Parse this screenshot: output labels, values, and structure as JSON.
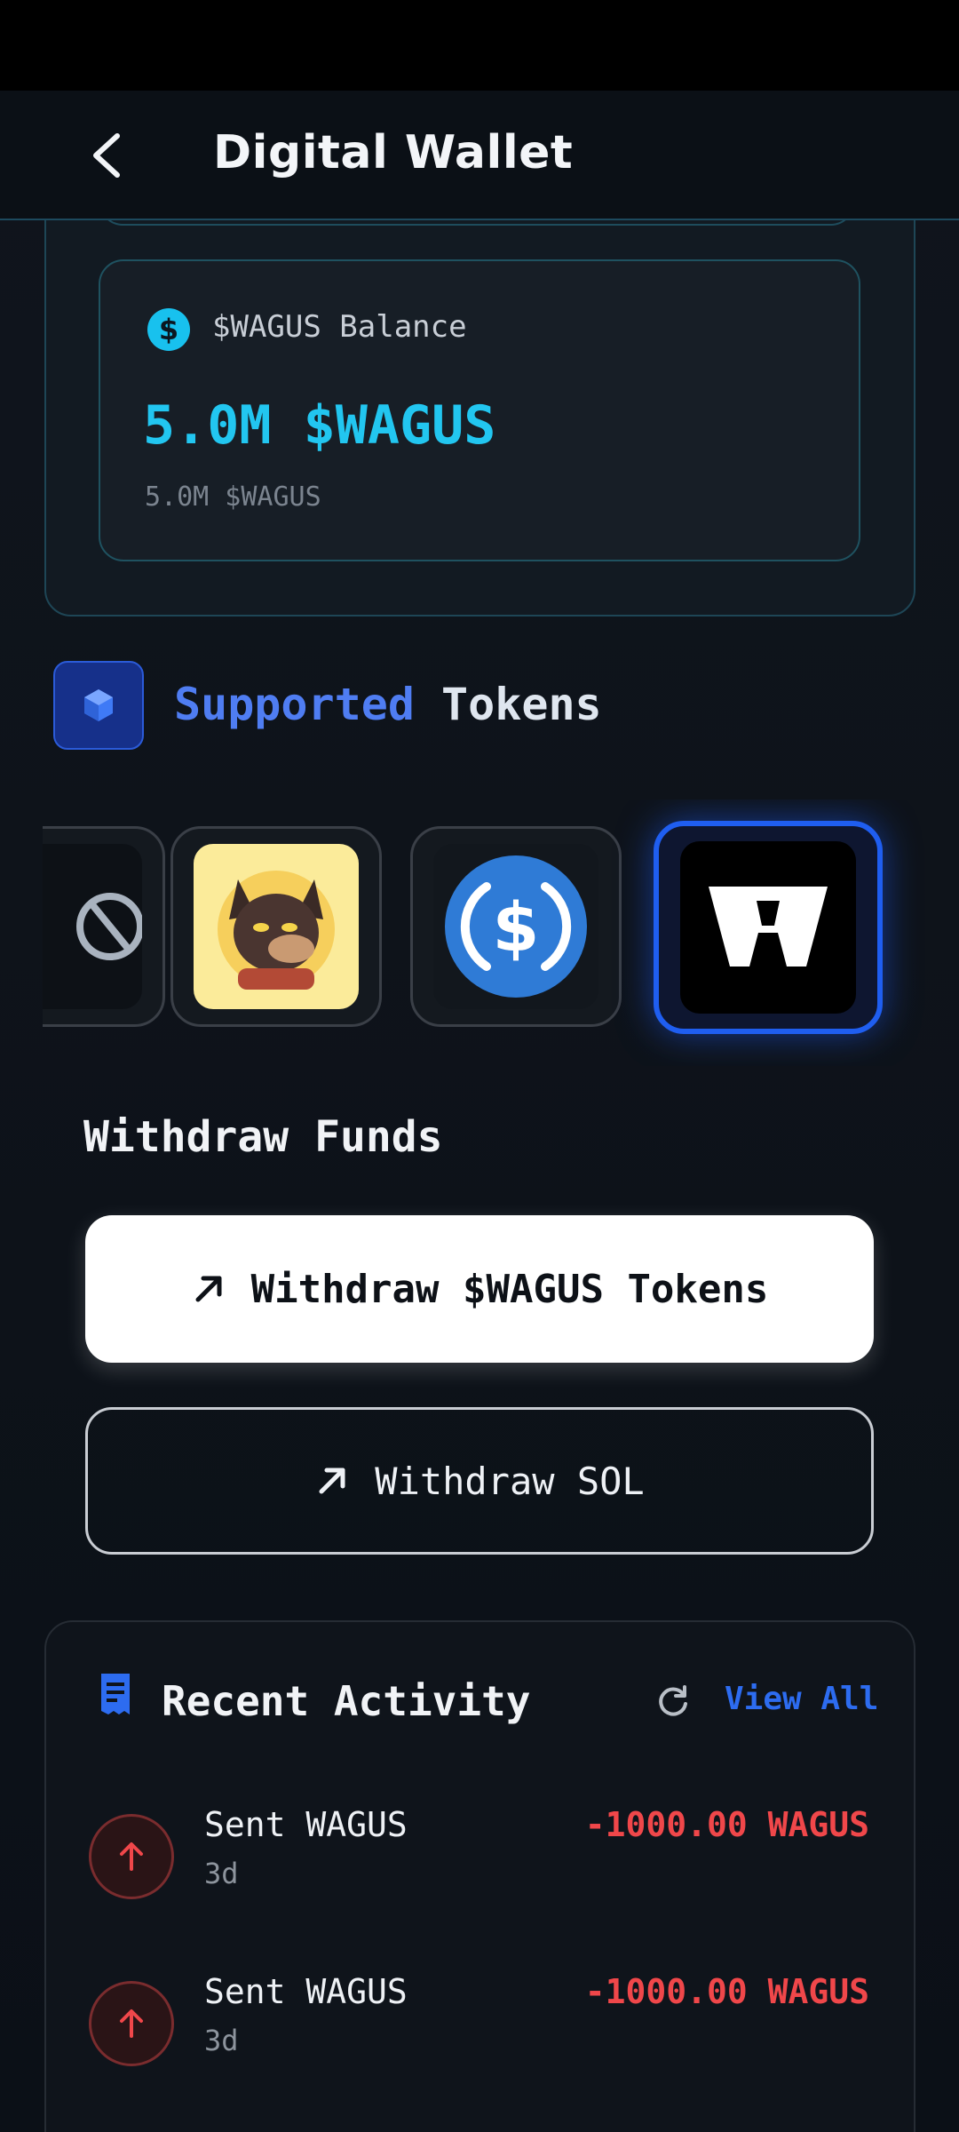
{
  "header": {
    "title": "Digital Wallet"
  },
  "balance": {
    "label": "$WAGUS Balance",
    "amount": "5.0M $WAGUS",
    "sub_amount": "5.0M $WAGUS"
  },
  "supported_tokens": {
    "title_highlight": "Supported",
    "title_rest": " Tokens",
    "tokens": [
      {
        "icon": "partial-token-icon"
      },
      {
        "icon": "wolf-token-icon"
      },
      {
        "icon": "usdc-icon"
      },
      {
        "icon": "wagus-logo-icon",
        "logo_text": "W",
        "selected": true
      }
    ]
  },
  "withdraw": {
    "title": "Withdraw Funds",
    "primary_label": "Withdraw $WAGUS Tokens",
    "secondary_label": "Withdraw SOL"
  },
  "activity": {
    "title": "Recent Activity",
    "view_all": "View All",
    "transactions": [
      {
        "label": "Sent WAGUS",
        "time": "3d",
        "amount": "-1000.00 WAGUS"
      },
      {
        "label": "Sent WAGUS",
        "time": "3d",
        "amount": "-1000.00 WAGUS"
      }
    ]
  },
  "colors": {
    "accent_cyan": "#22c6f0",
    "accent_blue": "#2d6cf0",
    "negative_red": "#f0474a",
    "background": "#0c1118"
  }
}
